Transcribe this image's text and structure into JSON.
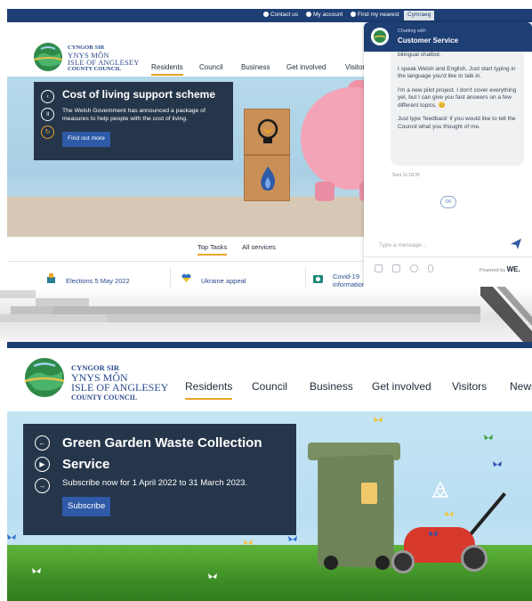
{
  "top_screenshot": {
    "utility_bar": {
      "contact_us": "Contact us",
      "my_account": "My account",
      "find_my_nearest": "Find my nearest",
      "language_toggle": "Cymraeg"
    },
    "logo": {
      "line1": "CYNGOR SIR",
      "line2": "YNYS MÔN",
      "line3": "ISLE OF ANGLESEY",
      "line4": "COUNTY COUNCIL"
    },
    "nav": [
      "Residents",
      "Council",
      "Business",
      "Get involved",
      "Visitors"
    ],
    "active_nav": "Residents",
    "hero": {
      "title": "Cost of living support scheme",
      "body": "The Welsh Government has announced a package of measures to help people with the cost of living.",
      "button": "Find out more"
    },
    "tabs": [
      "Top Tasks",
      "All services"
    ],
    "active_tab": "Top Tasks",
    "top_tasks": [
      "Elections 5 May 2022",
      "Ukraine appeal",
      "Covid-19 information"
    ],
    "chat": {
      "subtitle": "Chatting with",
      "title": "Customer Service",
      "messages": [
        "bilingual chatbot.",
        "I speak Welsh and English. Just start typing in the language you'd like to talk in.",
        "I'm a new pilot project. I don't cover everything yet, but I can give you fast answers on a few different topics. 😊",
        "Just type 'feedback' if you would like to tell the Council what you thought of me."
      ],
      "sent_stamp": "Sent 11:18:30",
      "ok_label": "OK",
      "input_placeholder": "Type a message...",
      "powered_by": "Powered by",
      "powered_brand": "WE."
    }
  },
  "bottom_screenshot": {
    "logo": {
      "line1": "CYNGOR SIR",
      "line2": "YNYS MÔN",
      "line3": "ISLE OF ANGLESEY",
      "line4": "COUNTY COUNCIL"
    },
    "nav": [
      "Residents",
      "Council",
      "Business",
      "Get involved",
      "Visitors",
      "News"
    ],
    "active_nav": "Residents",
    "hero": {
      "title": "Green Garden Waste Collection Service",
      "body": "Subscribe now for 1 April 2022 to 31 March 2023.",
      "button": "Subscribe"
    }
  },
  "colors": {
    "navy": "#1e3f73",
    "panel": "#26364a",
    "button_blue": "#2e5aa7",
    "accent_underline": "#e7a52a"
  }
}
